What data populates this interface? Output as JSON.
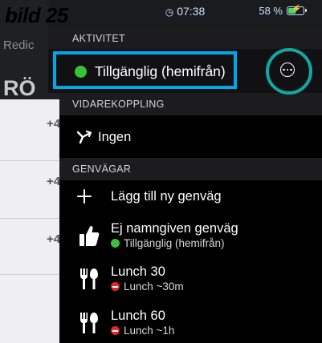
{
  "caption": "bild 25",
  "status_bar": {
    "time": "07:38",
    "battery_text": "58 %",
    "battery_level_percent": 58,
    "battery_charging": true
  },
  "background_app": {
    "title_partial": "Redic",
    "heading_partial": "RÖ",
    "list_prefixes": [
      "+4",
      "+4",
      "+4"
    ]
  },
  "activity": {
    "section_label": "AKTIVITET",
    "current": "Tillgänglig (hemifrån)",
    "status_color": "#3ac13a",
    "more_icon": "ellipsis-circle-icon"
  },
  "forwarding": {
    "section_label": "VIDAREKOPPLING",
    "value": "Ingen",
    "icon": "forward-arrow-icon"
  },
  "shortcuts": {
    "section_label": "GENVÄGAR",
    "add_label": "Lägg till ny genväg",
    "items": [
      {
        "title": "Ej namngiven genväg",
        "subtitle": "Tillgänglig (hemifrån)",
        "icon": "thumbs-up-icon",
        "status": "available"
      },
      {
        "title": "Lunch 30",
        "subtitle": "Lunch ~30m",
        "icon": "cutlery-icon",
        "status": "busy"
      },
      {
        "title": "Lunch 60",
        "subtitle": "Lunch ~1h",
        "icon": "cutlery-icon",
        "status": "busy"
      }
    ]
  },
  "colors": {
    "highlight_box": "#00a8e8",
    "highlight_ring": "#10a8a2",
    "available": "#3ac13a",
    "busy": "#e5252b"
  }
}
